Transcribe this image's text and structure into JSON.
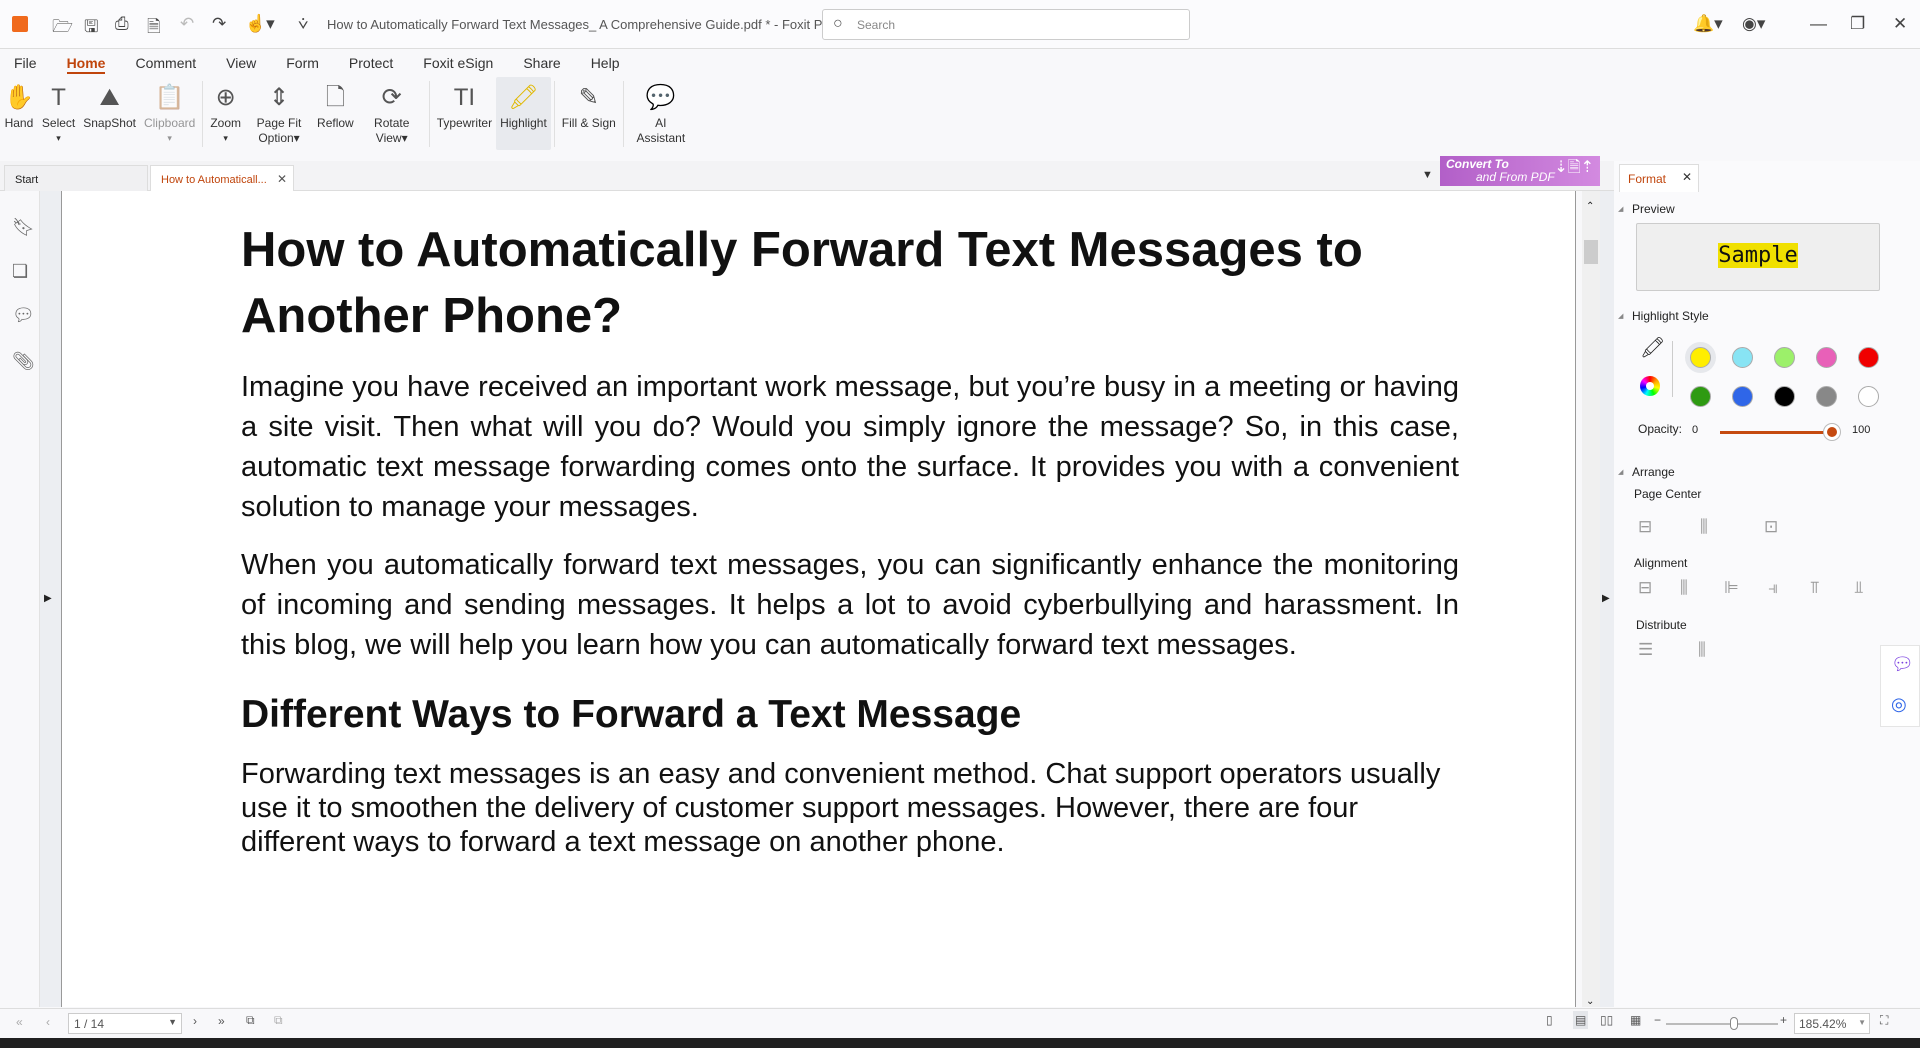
{
  "app": {
    "title": "How to Automatically Forward Text Messages_ A Comprehensive Guide.pdf * - Foxit PDF Reader",
    "search_placeholder": "Search"
  },
  "menu": [
    "File",
    "Home",
    "Comment",
    "View",
    "Form",
    "Protect",
    "Foxit eSign",
    "Share",
    "Help"
  ],
  "menu_active": "Home",
  "ribbon": [
    {
      "label": "Hand",
      "icon": "hand-icon",
      "glyph": "✋"
    },
    {
      "label": "Select",
      "icon": "select-text-icon",
      "glyph": "T",
      "dropdown": true
    },
    {
      "label": "SnapShot",
      "icon": "snapshot-icon",
      "glyph": "⛰"
    },
    {
      "label": "Clipboard",
      "icon": "clipboard-icon",
      "glyph": "📋",
      "dropdown": true,
      "disabled": true
    },
    {
      "label": "Zoom",
      "icon": "zoom-icon",
      "glyph": "⊕",
      "dropdown": true
    },
    {
      "label": "Page Fit Option▾",
      "icon": "page-fit-icon",
      "glyph": "⇕"
    },
    {
      "label": "Reflow",
      "icon": "reflow-icon",
      "glyph": "🗋"
    },
    {
      "label": "Rotate View▾",
      "icon": "rotate-view-icon",
      "glyph": "⟳"
    },
    {
      "label": "Typewriter",
      "icon": "typewriter-icon",
      "glyph": "TI"
    },
    {
      "label": "Highlight",
      "icon": "highlight-icon",
      "glyph": "🖍",
      "selected": true
    },
    {
      "label": "Fill & Sign",
      "icon": "fill-sign-icon",
      "glyph": "✎"
    },
    {
      "label": "AI Assistant",
      "icon": "ai-assistant-icon",
      "glyph": "💬"
    }
  ],
  "tabs": [
    {
      "label": "Start"
    },
    {
      "label": "How to Automaticall...",
      "active": true
    }
  ],
  "convert_banner": {
    "line1": "Convert To",
    "line2": "and From PDF"
  },
  "document": {
    "title": "How to Automatically Forward Text Messages to Another Phone?",
    "para1": "Imagine you have received an important work message, but you’re busy in a meeting or having a site visit. Then what will you do? Would you simply ignore the message? So, in this case, automatic text message forwarding comes onto the surface. It provides you with a convenient solution to manage your messages.",
    "para2": "When you automatically forward text messages, you can significantly enhance the monitoring of incoming and sending messages. It helps a lot to avoid cyberbullying and harassment. In this blog, we will help you learn how you can automatically forward text messages.",
    "heading2": "Different Ways to Forward a Text Message",
    "para3": "Forwarding text messages is an easy and convenient method. Chat support operators usually use it to smoothen the delivery of customer support messages. However, there are four different ways to forward a text message on another phone."
  },
  "format_panel": {
    "tab": "Format",
    "preview_label": "Preview",
    "sample": "Sample",
    "highlight_style": "Highlight Style",
    "colors": [
      "#ffee00",
      "#88e4f4",
      "#9cf06a",
      "#e860b8",
      "#f00000",
      "#2e9a12",
      "#2f66e8",
      "#000000",
      "#888888",
      "#ffffff"
    ],
    "selected_color": "#ffee00",
    "opacity_label": "Opacity:",
    "opacity_min": "0",
    "opacity_max": "100",
    "opacity_value": 100,
    "arrange": "Arrange",
    "page_center": "Page Center",
    "alignment": "Alignment",
    "distribute": "Distribute"
  },
  "status": {
    "page": "1 / 14",
    "zoom": "185.42%"
  },
  "accent": "#c0450c"
}
